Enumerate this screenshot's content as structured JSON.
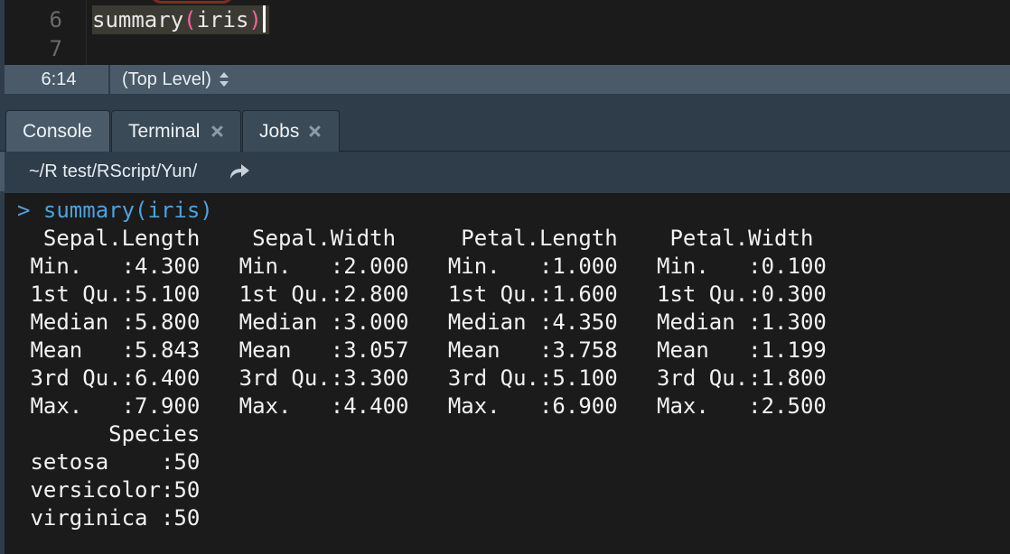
{
  "editor": {
    "lines": [
      {
        "number": "6",
        "code_fn": "summary",
        "code_open": "(",
        "code_arg": "iris",
        "code_close": ")"
      },
      {
        "number": "7"
      }
    ]
  },
  "status": {
    "cursor_position": "6:14",
    "scope": "(Top Level)"
  },
  "tabs": [
    {
      "label": "Console",
      "active": true,
      "closable": false
    },
    {
      "label": "Terminal",
      "active": false,
      "closable": true
    },
    {
      "label": "Jobs",
      "active": false,
      "closable": true
    }
  ],
  "path": {
    "working_dir": "~/R test/RScript/Yun/",
    "icon": "goto-directory-icon"
  },
  "console": {
    "prompt": ">",
    "command": "summary(iris)",
    "output_lines": [
      "  Sepal.Length    Sepal.Width     Petal.Length    Petal.Width   ",
      " Min.   :4.300   Min.   :2.000   Min.   :1.000   Min.   :0.100  ",
      " 1st Qu.:5.100   1st Qu.:2.800   1st Qu.:1.600   1st Qu.:0.300  ",
      " Median :5.800   Median :3.000   Median :4.350   Median :1.300  ",
      " Mean   :5.843   Mean   :3.057   Mean   :3.758   Mean   :1.199  ",
      " 3rd Qu.:6.400   3rd Qu.:3.300   3rd Qu.:5.100   3rd Qu.:1.800  ",
      " Max.   :7.900   Max.   :4.400   Max.   :6.900   Max.   :2.500  ",
      "       Species  ",
      " setosa    :50  ",
      " versicolor:50  ",
      " virginica :50  "
    ]
  },
  "colors": {
    "accent_blue": "#4aa3df",
    "paren_pink": "#ff5fa0",
    "chrome": "#2e3d49",
    "tab_active": "#4a5a68",
    "console_bg": "#1b1b1b"
  }
}
